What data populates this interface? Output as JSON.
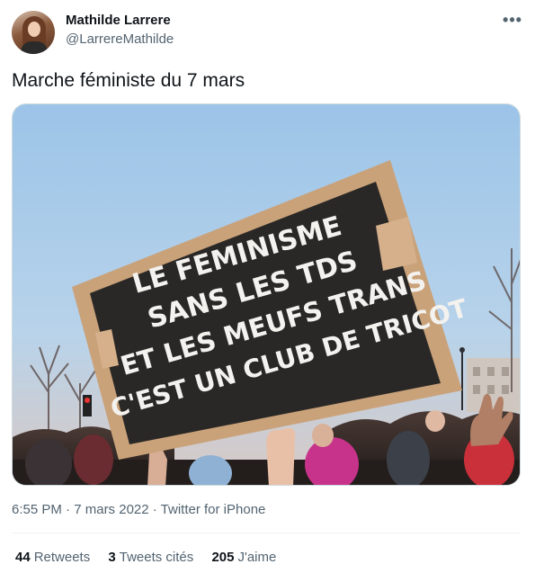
{
  "author": {
    "name": "Mathilde Larrere",
    "handle": "@LarrereMathilde"
  },
  "more_icon": "more-horizontal-icon",
  "tweet": {
    "text": "Marche féministe du 7 mars"
  },
  "media": {
    "sign_lines": [
      "LE FEMINISME",
      "SANS LES TDS",
      "ET LES MEUFS TRANS",
      "C'EST UN CLUB DE TRICOT"
    ]
  },
  "meta": {
    "time": "6:55 PM",
    "sep1": " · ",
    "date": "7 mars 2022",
    "sep2": " · ",
    "source": "Twitter for iPhone"
  },
  "stats": {
    "retweets_count": "44",
    "retweets_label": "Retweets",
    "quotes_count": "3",
    "quotes_label": "Tweets cités",
    "likes_count": "205",
    "likes_label": "J'aime"
  },
  "colors": {
    "text": "#0f1419",
    "secondary": "#536471",
    "border": "#cfd9de",
    "sky_top": "#9bc3e6",
    "sign_board": "#2a2826",
    "cardboard": "#c9a27a"
  }
}
